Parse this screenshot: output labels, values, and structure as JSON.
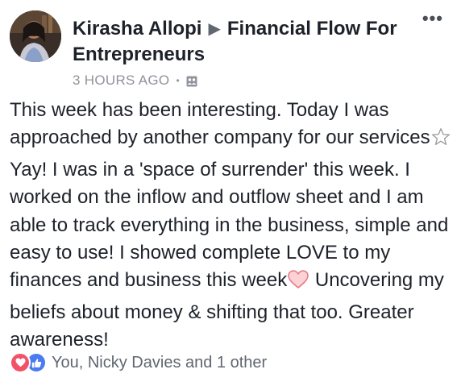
{
  "post": {
    "author": "Kirasha Allopi",
    "arrow_glyph": "▶",
    "group": "Financial Flow For Entrepreneurs",
    "timestamp": "3 HOURS AGO",
    "separator": "•",
    "privacy_icon": "group-icon",
    "more_glyph": "•••",
    "text_segments": {
      "part1": "This week has been interesting. Today I was approached by another company for our services",
      "part2": "Yay! I was in a 'space of surrender' this week. I worked on the inflow and outflow sheet and I am able to track everything in the business, simple and easy to use! I showed complete LOVE to my finances and business this week",
      "part3": " Uncovering my beliefs about money & shifting that too. Greater awareness!"
    },
    "emoji": {
      "star": "star-emoji",
      "heart": "heart-emoji"
    },
    "reactions": {
      "icons": [
        "love-reaction-icon",
        "like-reaction-icon"
      ],
      "summary": "You, Nicky Davies and 1 other"
    }
  },
  "colors": {
    "text": "#1d2129",
    "meta": "#90949c",
    "love": "#f25268",
    "like": "#4a7bf0"
  }
}
